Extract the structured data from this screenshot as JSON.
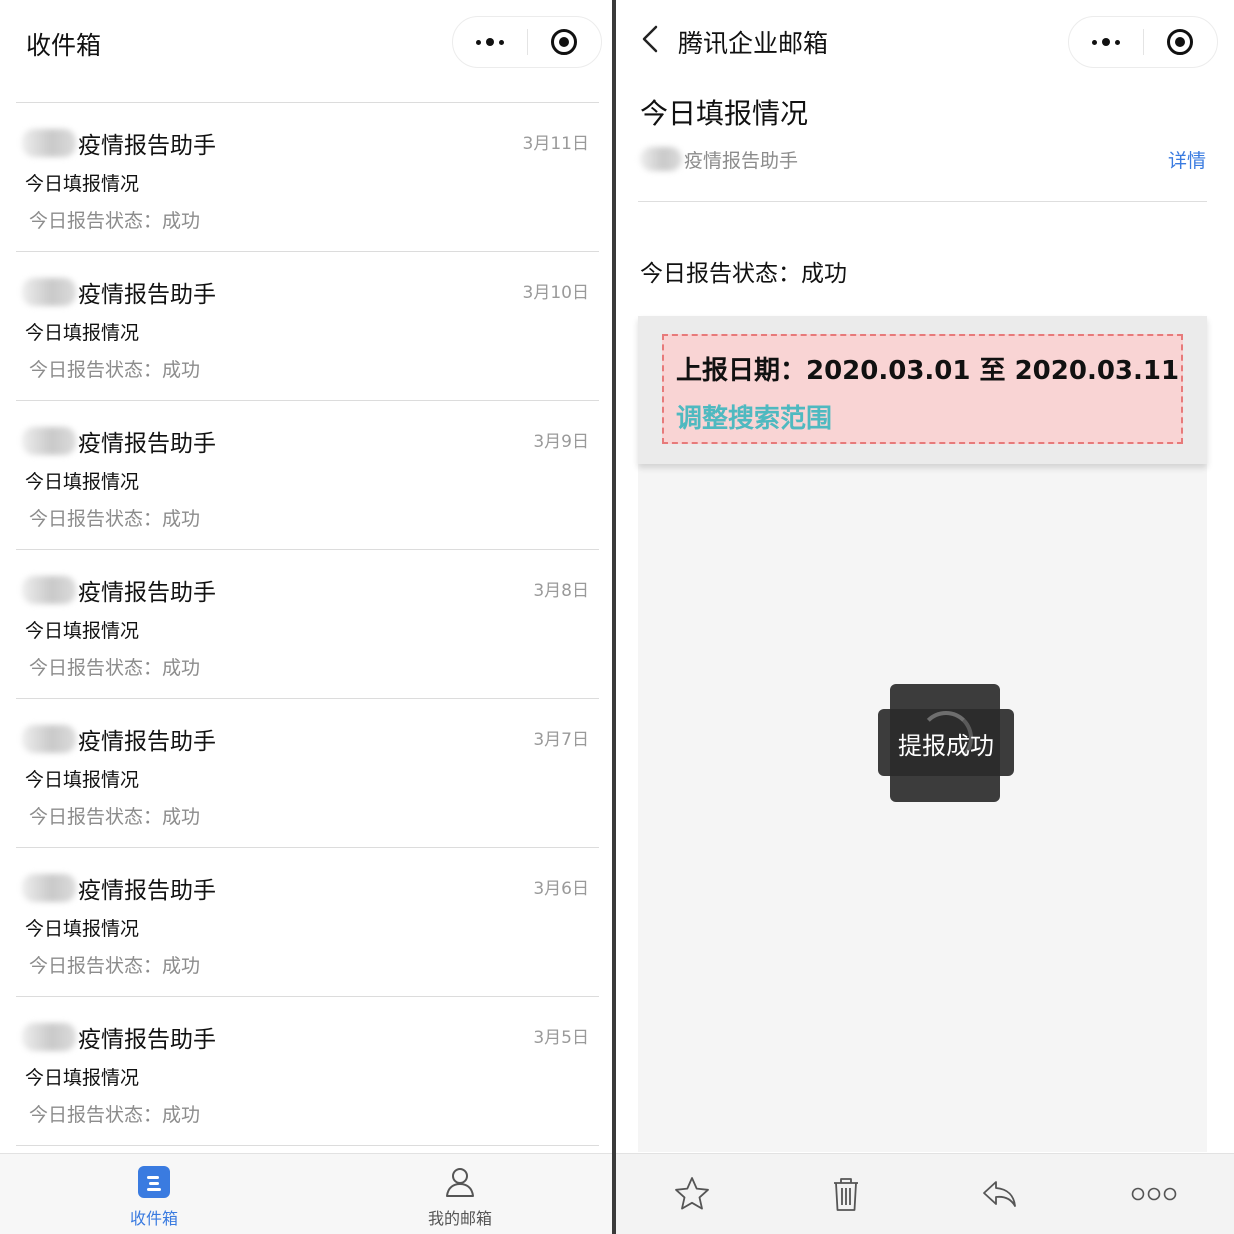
{
  "left_panel": {
    "title": "收件箱",
    "mails": [
      {
        "sender": "疫情报告助手",
        "date": "3月11日",
        "subject": "今日填报情况",
        "preview": "今日报告状态：成功"
      },
      {
        "sender": "疫情报告助手",
        "date": "3月10日",
        "subject": "今日填报情况",
        "preview": "今日报告状态：成功"
      },
      {
        "sender": "疫情报告助手",
        "date": "3月9日",
        "subject": "今日填报情况",
        "preview": "今日报告状态：成功"
      },
      {
        "sender": "疫情报告助手",
        "date": "3月8日",
        "subject": "今日填报情况",
        "preview": "今日报告状态：成功"
      },
      {
        "sender": "疫情报告助手",
        "date": "3月7日",
        "subject": "今日填报情况",
        "preview": "今日报告状态：成功"
      },
      {
        "sender": "疫情报告助手",
        "date": "3月6日",
        "subject": "今日填报情况",
        "preview": "今日报告状态：成功"
      },
      {
        "sender": "疫情报告助手",
        "date": "3月5日",
        "subject": "今日填报情况",
        "preview": "今日报告状态：成功"
      }
    ],
    "tabs": [
      {
        "label": "收件箱",
        "icon": "inbox-icon",
        "active": true
      },
      {
        "label": "我的邮箱",
        "icon": "person-icon",
        "active": false
      }
    ]
  },
  "right_panel": {
    "title": "腾讯企业邮箱",
    "mail": {
      "subject": "今日填报情况",
      "sender": "疫情报告助手",
      "details_label": "详情",
      "status_line": "今日报告状态：成功",
      "date_range": "上报日期：2020.03.01 至 2020.03.11",
      "adjust_label": "调整搜索范围"
    },
    "toast": "提报成功",
    "actions": [
      "star-icon",
      "trash-icon",
      "reply-icon",
      "more-icon"
    ]
  },
  "colors": {
    "accent": "#3a7be0",
    "link_teal": "#4fb9c0",
    "highlight_box": "#f9d4d4",
    "highlight_border": "#e77a7a"
  }
}
